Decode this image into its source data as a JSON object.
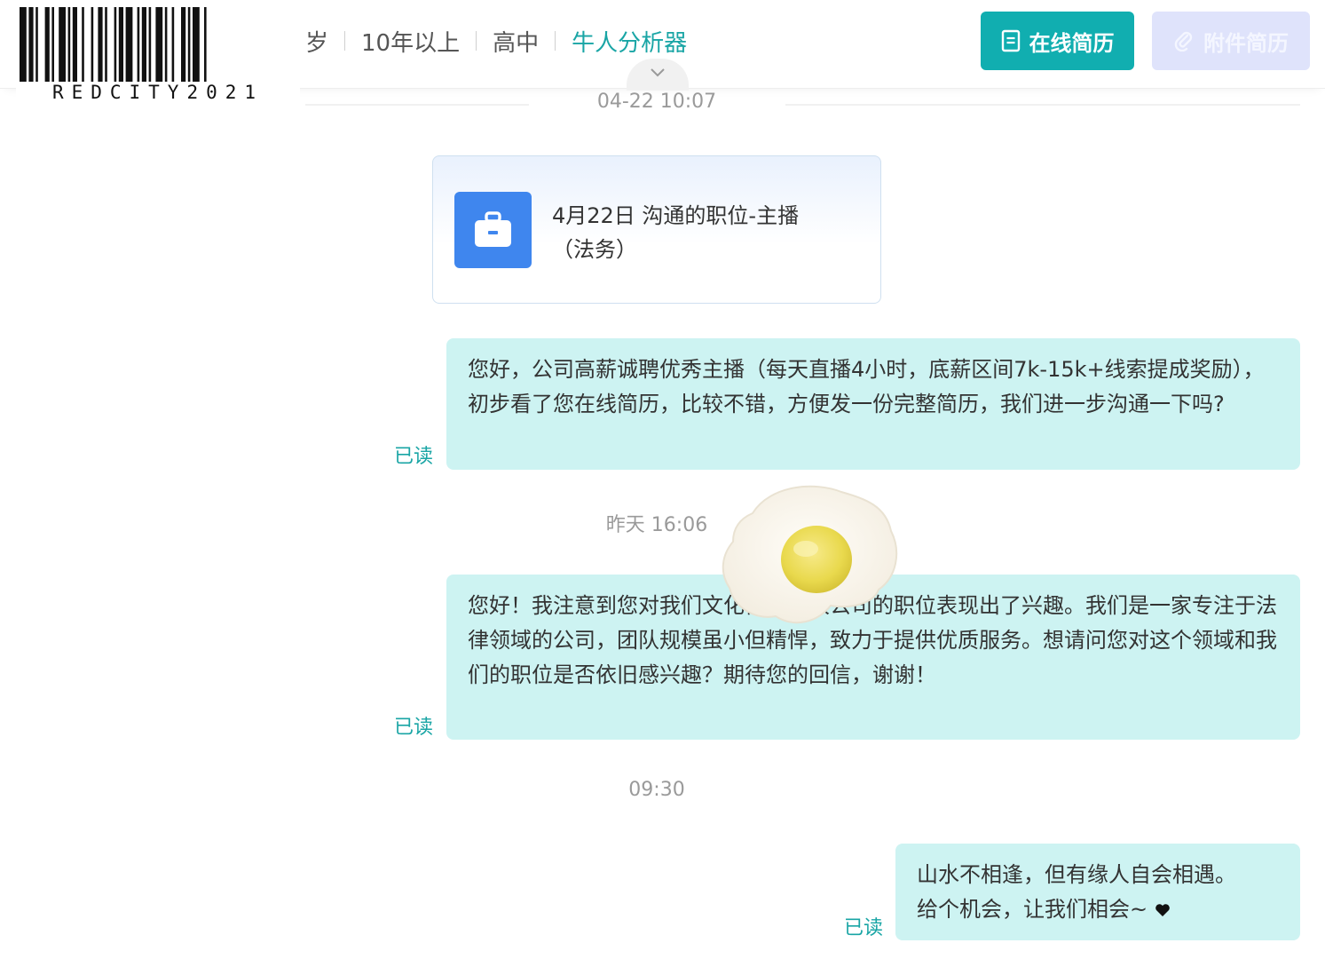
{
  "header": {
    "profile": {
      "age_suffix": "岁",
      "experience": "10年以上",
      "education": "高中",
      "analyzer_link": "牛人分析器"
    },
    "buttons": {
      "online_resume": "在线简历",
      "attachment_resume": "附件简历"
    },
    "watermark": "REDCITY2021"
  },
  "chat": {
    "timestamps": [
      "04-22 10:07",
      "昨天 16:06",
      "09:30"
    ],
    "job_card": {
      "title_line1": "4月22日 沟通的职位-主播",
      "title_line2": "（法务）"
    },
    "messages": [
      {
        "text": "您好，公司高薪诚聘优秀主播（每天直播4小时，底薪区间7k-15k+线索提成奖励），初步看了您在线简历，比较不错，方便发一份完整简历，我们进一步沟通一下吗?",
        "status": "已读"
      },
      {
        "text": "您好！我注意到您对我们文化传媒有限公司的职位表现出了兴趣。我们是一家专注于法律领域的公司，团队规模虽小但精悍，致力于提供优质服务。想请问您对这个领域和我们的职位是否依旧感兴趣？期待您的回信，谢谢！",
        "status": "已读"
      },
      {
        "text_line1": "山水不相逢，但有缘人自会相遇。",
        "text_line2": "给个机会，让我们相会~",
        "status": "已读"
      }
    ]
  },
  "colors": {
    "accent": "#11aeb0",
    "link": "#19a5a5",
    "bubble": "#cdf3f2",
    "job_icon": "#3f86ee",
    "attach_button": "#dfe3fb"
  },
  "icons": [
    "resume-doc-icon",
    "paperclip-icon",
    "chevron-down-icon",
    "briefcase-icon",
    "heart-icon",
    "fried-egg-sticker"
  ]
}
